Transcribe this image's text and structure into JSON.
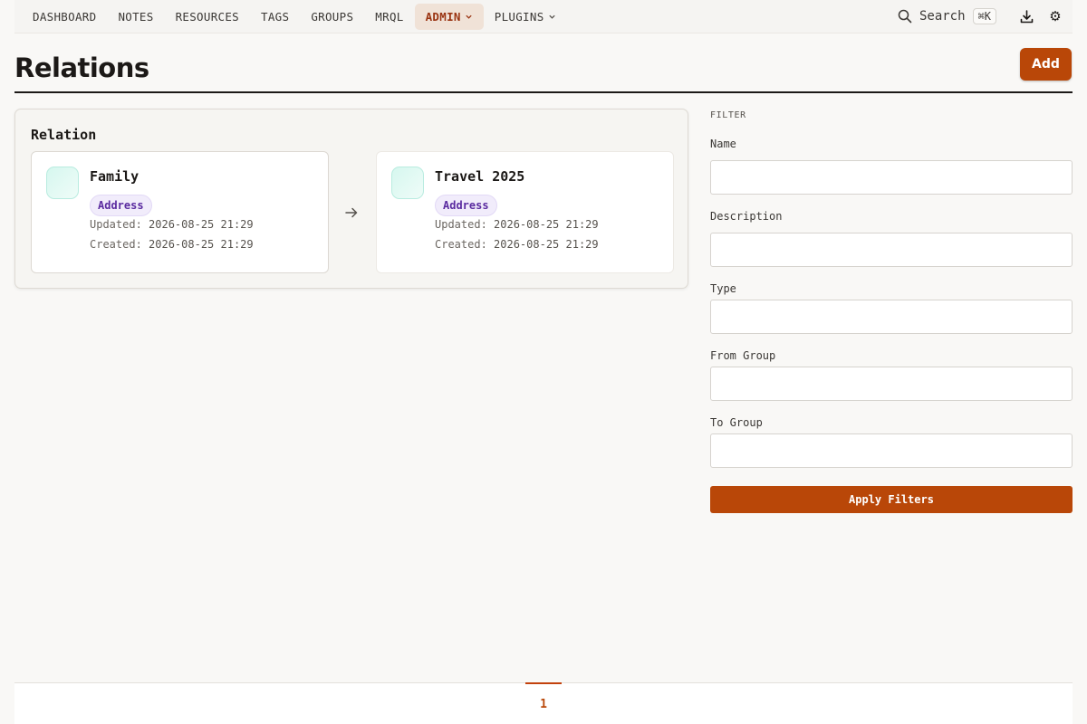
{
  "nav": {
    "items": [
      {
        "label": "DASHBOARD"
      },
      {
        "label": "NOTES"
      },
      {
        "label": "RESOURCES"
      },
      {
        "label": "TAGS"
      },
      {
        "label": "GROUPS"
      },
      {
        "label": "MRQL"
      },
      {
        "label": "ADMIN"
      },
      {
        "label": "PLUGINS"
      }
    ],
    "active": "ADMIN",
    "search_label": "Search",
    "search_shortcut": "⌘K",
    "download_icon": "download-icon",
    "settings_icon": "⚙"
  },
  "header": {
    "title": "Relations",
    "add_label": "Add"
  },
  "relation": {
    "title": "Relation",
    "from": {
      "name": "Family",
      "type": "Address",
      "updated_label": "Updated:",
      "updated": "2026-08-25 21:29",
      "created_label": "Created:",
      "created": "2026-08-25 21:29"
    },
    "to": {
      "name": "Travel 2025",
      "type": "Address",
      "updated_label": "Updated:",
      "updated": "2026-08-25 21:29",
      "created_label": "Created:",
      "created": "2026-08-25 21:29"
    }
  },
  "filter": {
    "heading": "FILTER",
    "fields": {
      "name": {
        "label": "Name",
        "value": ""
      },
      "description": {
        "label": "Description",
        "value": ""
      },
      "type": {
        "label": "Type",
        "value": ""
      },
      "from_group": {
        "label": "From Group",
        "value": ""
      },
      "to_group": {
        "label": "To Group",
        "value": ""
      }
    },
    "apply_label": "Apply Filters"
  },
  "pagination": {
    "current": "1"
  },
  "colors": {
    "accent": "#b94708",
    "badge_text": "#5b2ca0",
    "avatar": "#d6f7ef"
  }
}
